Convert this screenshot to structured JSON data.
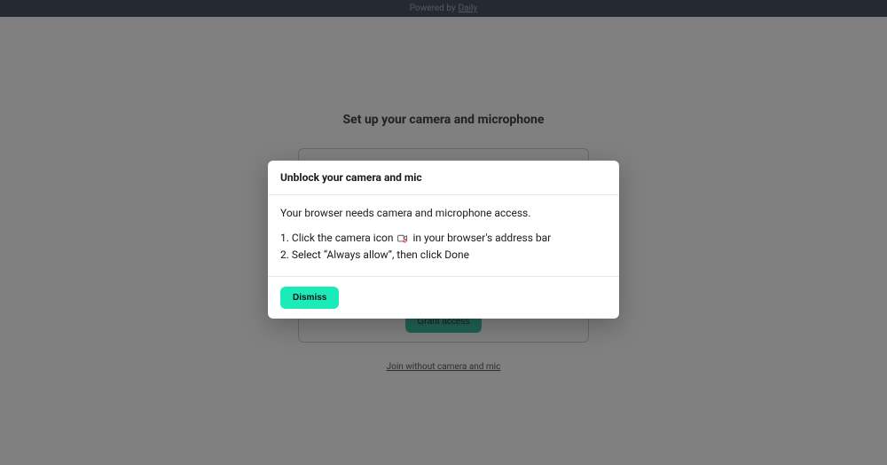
{
  "header": {
    "powered_by_text": "Powered by",
    "brand_link": "Daily"
  },
  "setup": {
    "title": "Set up your camera and microphone",
    "grant_button": "Grant access",
    "join_without_link": "Join without camera and mic"
  },
  "modal": {
    "title": "Unblock your camera and mic",
    "intro": "Your browser needs camera and microphone access.",
    "step1_prefix": "1. Click the camera icon",
    "step1_suffix": "in your browser's address bar",
    "step2": "2. Select “Always allow”, then click Done",
    "dismiss_button": "Dismiss"
  },
  "colors": {
    "accent_teal": "#1bebb9",
    "brand_green": "#1aa68c",
    "header_bg": "#1f2d3d"
  }
}
